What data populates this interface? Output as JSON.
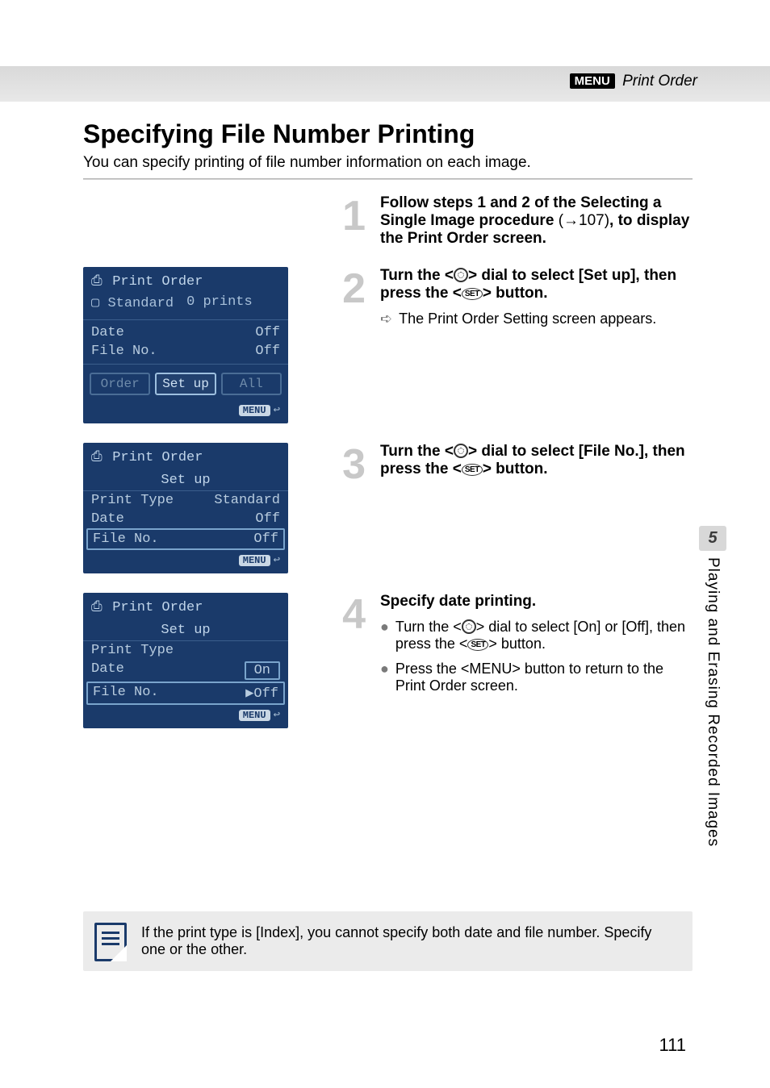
{
  "header": {
    "menu_badge": "MENU",
    "breadcrumb": "Print Order"
  },
  "title": "Specifying File Number Printing",
  "subtitle": "You can specify printing of file number information on each image.",
  "sidetab": {
    "num": "5",
    "text": "Playing and Erasing Recorded Images"
  },
  "steps": [
    {
      "num": "1",
      "body_strong_a": "Follow steps 1 and 2 of the Selecting a  Single Image procedure",
      "body_ref": "(→107)",
      "body_strong_b": ", to display the Print Order screen."
    },
    {
      "num": "2",
      "body_a": "Turn the <",
      "body_b": "> dial to select [Set up], then press the <",
      "body_c": "> button.",
      "sub_arrow": "➪",
      "sub_text": "The Print Order Setting screen appears.",
      "lcd": {
        "title": "Print Order",
        "sub_a": "Standard",
        "sub_b": "0 prints",
        "rows": [
          {
            "k": "Date",
            "v": "Off"
          },
          {
            "k": "File No.",
            "v": "Off"
          }
        ],
        "btns": [
          "Order",
          "Set up",
          "All"
        ],
        "selected": 1,
        "foot": "MENU"
      }
    },
    {
      "num": "3",
      "body_a": "Turn the <",
      "body_b": "> dial to select [File No.], then press the <",
      "body_c": "> button.",
      "lcd": {
        "title": "Print Order",
        "setup_hdr": "Set up",
        "rows": [
          {
            "k": "Print Type",
            "v": "Standard"
          },
          {
            "k": "Date",
            "v": "Off"
          },
          {
            "k": "File No.",
            "v": "Off",
            "boxed": true
          }
        ],
        "foot": "MENU"
      }
    },
    {
      "num": "4",
      "heading": "Specify date printing.",
      "subs": [
        {
          "bullet": "●",
          "a": "Turn the <",
          "b": "> dial to select [On] or [Off], then press the <",
          "c": "> button."
        },
        {
          "bullet": "●",
          "text": "Press the <MENU> button to return to the Print Order screen."
        }
      ],
      "lcd": {
        "title": "Print Order",
        "setup_hdr": "Set up",
        "rows": [
          {
            "k": "Print Type",
            "v": ""
          },
          {
            "k": "Date",
            "v": "On",
            "valboxed": true
          },
          {
            "k": "File No.",
            "v": "▶Off",
            "boxed": true
          }
        ],
        "foot": "MENU"
      }
    }
  ],
  "note": "If the print type is [Index], you cannot specify both date and file number. Specify one or the other.",
  "set_label": "SET",
  "page_number": "111"
}
